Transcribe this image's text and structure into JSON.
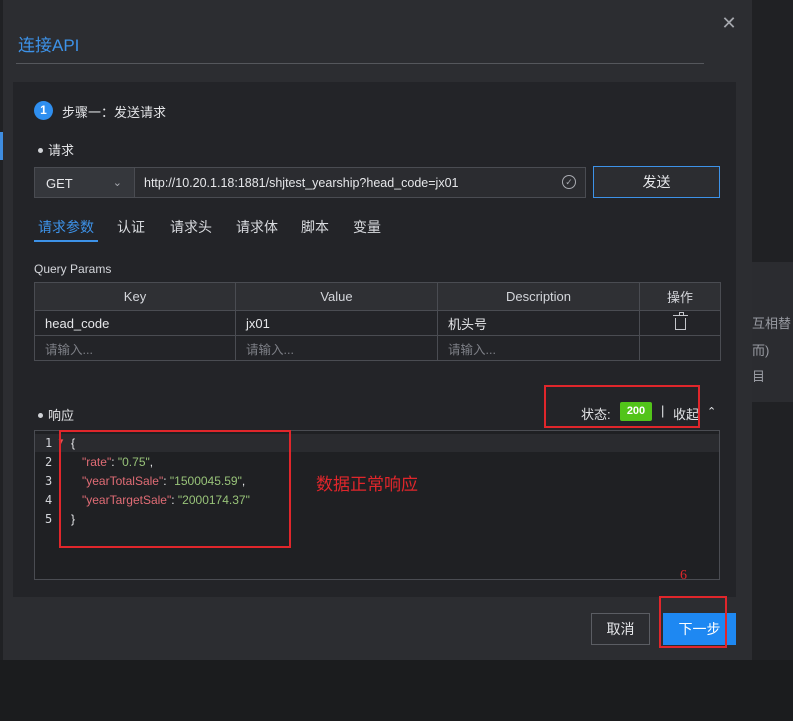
{
  "background": {
    "side_text": [
      "互相替",
      "而)",
      "目"
    ]
  },
  "dialog": {
    "title": "连接API",
    "close_symbol": "✕",
    "step": {
      "number": "1",
      "label": "步骤一：发送请求"
    },
    "request": {
      "section_label": "请求",
      "method": "GET",
      "url": "http://10.20.1.18:1881/shjtest_yearship?head_code=jx01",
      "send_label": "发送"
    },
    "tabs": [
      "请求参数",
      "认证",
      "请求头",
      "请求体",
      "脚本",
      "变量"
    ],
    "active_tab": "请求参数",
    "query_params": {
      "label": "Query Params",
      "columns": [
        "Key",
        "Value",
        "Description",
        "操作"
      ],
      "rows": [
        {
          "key": "head_code",
          "value": "jx01",
          "description": "机头号"
        }
      ],
      "placeholder": "请输入..."
    },
    "response": {
      "section_label": "响应",
      "status_label": "状态:",
      "status_code": "200",
      "separator": "|",
      "collapse_label": "收起",
      "line_numbers": [
        "1",
        "2",
        "3",
        "4",
        "5"
      ],
      "json_lines": {
        "open": "{",
        "rate_key": "\"rate\"",
        "rate_value": "\"0.75\"",
        "total_key": "\"yearTotalSale\"",
        "total_value": "\"1500045.59\"",
        "target_key": "\"yearTargetSale\"",
        "target_value": "\"2000174.37\"",
        "close": "}"
      }
    },
    "footer": {
      "cancel_label": "取消",
      "next_label": "下一步"
    }
  },
  "annotations": {
    "response_note": "数据正常响应",
    "step_number": "6",
    "color": "#e0262b"
  },
  "colors": {
    "accent": "#3d92e8",
    "primary_button": "#1e88f2",
    "success": "#52c41a"
  }
}
